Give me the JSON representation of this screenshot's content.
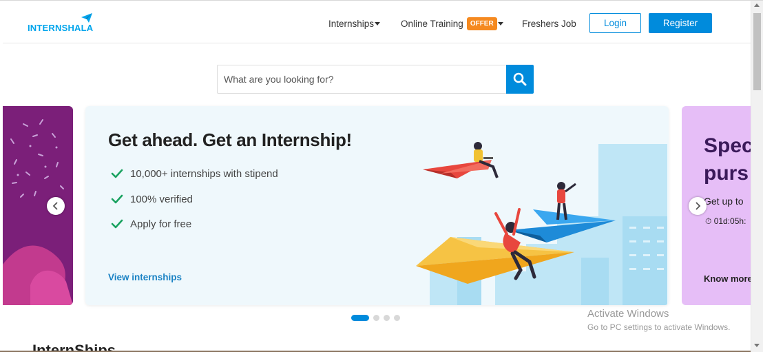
{
  "header": {
    "logo_text": "INTERNSHALA",
    "nav": {
      "internships": "Internships",
      "online_training": "Online Training",
      "offer_badge": "OFFER",
      "freshers_job": "Freshers Job"
    },
    "login_label": "Login",
    "register_label": "Register"
  },
  "search": {
    "placeholder": "What are you looking for?",
    "icon": "search-icon"
  },
  "carousel": {
    "main_slide": {
      "headline": "Get ahead. Get an Internship!",
      "features": [
        "10,000+ internships with stipend",
        "100% verified",
        "Apply for free"
      ],
      "cta": "View internships"
    },
    "next_slide": {
      "title_line1": "Spec",
      "title_line2": "purs",
      "subtitle": "Get up to",
      "timer": "⏱ 01d:05h:",
      "cta": "Know more"
    },
    "active_index": 0,
    "slide_count": 4
  },
  "watermark": {
    "title": "Activate Windows",
    "subtitle": "Go to PC settings to activate Windows."
  },
  "section": {
    "title": "InternShips"
  },
  "colors": {
    "brand_blue": "#008bdc",
    "offer_orange": "#f5891f",
    "check_green": "#1aa260",
    "slide_bg": "#eff8fc"
  }
}
